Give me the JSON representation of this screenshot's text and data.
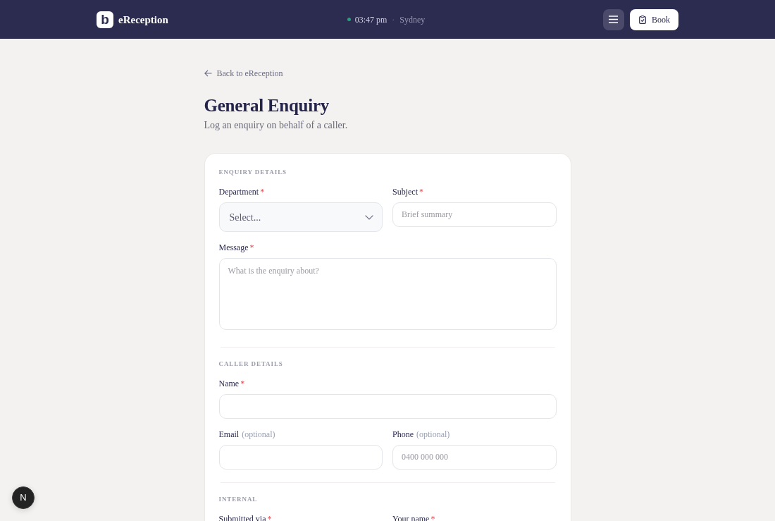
{
  "header": {
    "logo_mark": "b",
    "app_name": "eReception",
    "time": "03:47 pm",
    "separator": "·",
    "city": "Sydney",
    "book_button": "Book"
  },
  "back_link": "Back to eReception",
  "title": "General Enquiry",
  "subtitle": "Log an enquiry on behalf of a caller.",
  "required_mark": "*",
  "sections": [
    {
      "heading": "ENQUIRY DETAILS",
      "rows": [
        [
          {
            "kind": "select",
            "label": "Department",
            "required": true,
            "placeholder": "Select..."
          },
          {
            "kind": "text",
            "label": "Subject",
            "required": true,
            "placeholder": "Brief summary"
          }
        ],
        [
          {
            "kind": "textarea",
            "label": "Message",
            "required": true,
            "placeholder": "What is the enquiry about?"
          }
        ]
      ]
    },
    {
      "heading": "CALLER DETAILS",
      "rows": [
        [
          {
            "kind": "text",
            "label": "Name",
            "required": true
          }
        ],
        [
          {
            "kind": "text",
            "label": "Email",
            "required": false,
            "note": "(optional)"
          },
          {
            "kind": "text",
            "label": "Phone",
            "required": false,
            "note": "(optional)",
            "placeholder": "0400 000 000"
          }
        ]
      ]
    },
    {
      "heading": "INTERNAL",
      "rows": [
        [
          {
            "label": "Submitted via",
            "required": true
          },
          {
            "label": "Your name",
            "required": true
          }
        ]
      ]
    }
  ],
  "dev_badge": "N"
}
